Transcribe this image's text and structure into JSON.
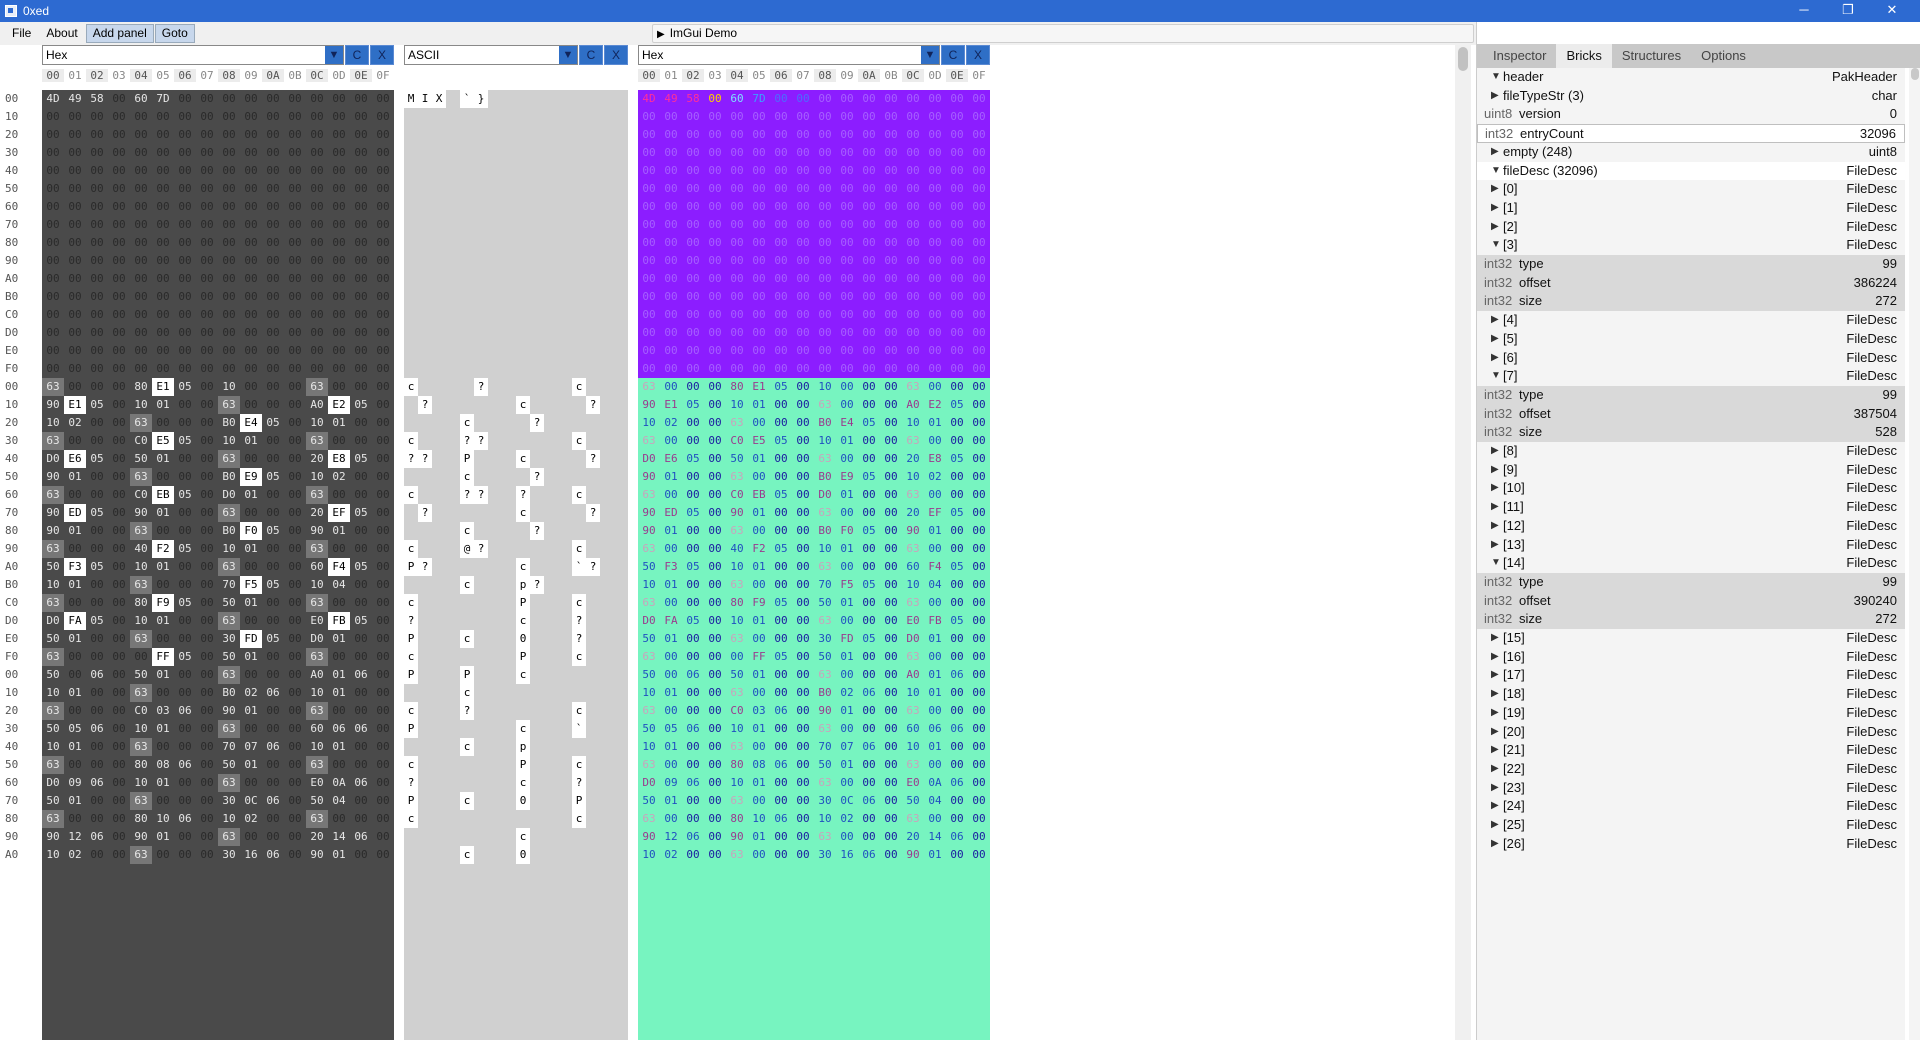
{
  "window": {
    "title": "0xed",
    "controls": [
      "─",
      "❐",
      "✕"
    ]
  },
  "menu": {
    "items": [
      "File",
      "About",
      "Add panel",
      "Goto"
    ],
    "demo_label": "ImGui Demo"
  },
  "panels": [
    {
      "name": "Hex",
      "buttons": [
        "C",
        "X"
      ]
    },
    {
      "name": "ASCII",
      "buttons": [
        "C",
        "X"
      ]
    },
    {
      "name": "Hex",
      "buttons": [
        "C",
        "X"
      ]
    }
  ],
  "col_headers": [
    "00",
    "01",
    "02",
    "03",
    "04",
    "05",
    "06",
    "07",
    "08",
    "09",
    "0A",
    "0B",
    "0C",
    "0D",
    "0E",
    "0F"
  ],
  "row_labels": [
    "00",
    "10",
    "20",
    "30",
    "40",
    "50",
    "60",
    "70",
    "80",
    "90",
    "A0",
    "B0",
    "C0",
    "D0",
    "E0",
    "F0",
    "00",
    "10",
    "20",
    "30",
    "40",
    "50",
    "60",
    "70",
    "80",
    "90",
    "A0",
    "B0",
    "C0",
    "D0",
    "E0",
    "F0",
    "00",
    "10",
    "20",
    "30",
    "40",
    "50",
    "60",
    "70",
    "80",
    "90",
    "A0"
  ],
  "hex_rows": [
    [
      "4D",
      "49",
      "58",
      "00",
      "60",
      "7D",
      "00",
      "00",
      "00",
      "00",
      "00",
      "00",
      "00",
      "00",
      "00",
      "00"
    ],
    [
      "00",
      "00",
      "00",
      "00",
      "00",
      "00",
      "00",
      "00",
      "00",
      "00",
      "00",
      "00",
      "00",
      "00",
      "00",
      "00"
    ],
    [
      "00",
      "00",
      "00",
      "00",
      "00",
      "00",
      "00",
      "00",
      "00",
      "00",
      "00",
      "00",
      "00",
      "00",
      "00",
      "00"
    ],
    [
      "00",
      "00",
      "00",
      "00",
      "00",
      "00",
      "00",
      "00",
      "00",
      "00",
      "00",
      "00",
      "00",
      "00",
      "00",
      "00"
    ],
    [
      "00",
      "00",
      "00",
      "00",
      "00",
      "00",
      "00",
      "00",
      "00",
      "00",
      "00",
      "00",
      "00",
      "00",
      "00",
      "00"
    ],
    [
      "00",
      "00",
      "00",
      "00",
      "00",
      "00",
      "00",
      "00",
      "00",
      "00",
      "00",
      "00",
      "00",
      "00",
      "00",
      "00"
    ],
    [
      "00",
      "00",
      "00",
      "00",
      "00",
      "00",
      "00",
      "00",
      "00",
      "00",
      "00",
      "00",
      "00",
      "00",
      "00",
      "00"
    ],
    [
      "00",
      "00",
      "00",
      "00",
      "00",
      "00",
      "00",
      "00",
      "00",
      "00",
      "00",
      "00",
      "00",
      "00",
      "00",
      "00"
    ],
    [
      "00",
      "00",
      "00",
      "00",
      "00",
      "00",
      "00",
      "00",
      "00",
      "00",
      "00",
      "00",
      "00",
      "00",
      "00",
      "00"
    ],
    [
      "00",
      "00",
      "00",
      "00",
      "00",
      "00",
      "00",
      "00",
      "00",
      "00",
      "00",
      "00",
      "00",
      "00",
      "00",
      "00"
    ],
    [
      "00",
      "00",
      "00",
      "00",
      "00",
      "00",
      "00",
      "00",
      "00",
      "00",
      "00",
      "00",
      "00",
      "00",
      "00",
      "00"
    ],
    [
      "00",
      "00",
      "00",
      "00",
      "00",
      "00",
      "00",
      "00",
      "00",
      "00",
      "00",
      "00",
      "00",
      "00",
      "00",
      "00"
    ],
    [
      "00",
      "00",
      "00",
      "00",
      "00",
      "00",
      "00",
      "00",
      "00",
      "00",
      "00",
      "00",
      "00",
      "00",
      "00",
      "00"
    ],
    [
      "00",
      "00",
      "00",
      "00",
      "00",
      "00",
      "00",
      "00",
      "00",
      "00",
      "00",
      "00",
      "00",
      "00",
      "00",
      "00"
    ],
    [
      "00",
      "00",
      "00",
      "00",
      "00",
      "00",
      "00",
      "00",
      "00",
      "00",
      "00",
      "00",
      "00",
      "00",
      "00",
      "00"
    ],
    [
      "00",
      "00",
      "00",
      "00",
      "00",
      "00",
      "00",
      "00",
      "00",
      "00",
      "00",
      "00",
      "00",
      "00",
      "00",
      "00"
    ],
    [
      "63",
      "00",
      "00",
      "00",
      "80",
      "E1",
      "05",
      "00",
      "10",
      "00",
      "00",
      "00",
      "63",
      "00",
      "00",
      "00"
    ],
    [
      "90",
      "E1",
      "05",
      "00",
      "10",
      "01",
      "00",
      "00",
      "63",
      "00",
      "00",
      "00",
      "A0",
      "E2",
      "05",
      "00"
    ],
    [
      "10",
      "02",
      "00",
      "00",
      "63",
      "00",
      "00",
      "00",
      "B0",
      "E4",
      "05",
      "00",
      "10",
      "01",
      "00",
      "00"
    ],
    [
      "63",
      "00",
      "00",
      "00",
      "C0",
      "E5",
      "05",
      "00",
      "10",
      "01",
      "00",
      "00",
      "63",
      "00",
      "00",
      "00"
    ],
    [
      "D0",
      "E6",
      "05",
      "00",
      "50",
      "01",
      "00",
      "00",
      "63",
      "00",
      "00",
      "00",
      "20",
      "E8",
      "05",
      "00"
    ],
    [
      "90",
      "01",
      "00",
      "00",
      "63",
      "00",
      "00",
      "00",
      "B0",
      "E9",
      "05",
      "00",
      "10",
      "02",
      "00",
      "00"
    ],
    [
      "63",
      "00",
      "00",
      "00",
      "C0",
      "EB",
      "05",
      "00",
      "D0",
      "01",
      "00",
      "00",
      "63",
      "00",
      "00",
      "00"
    ],
    [
      "90",
      "ED",
      "05",
      "00",
      "90",
      "01",
      "00",
      "00",
      "63",
      "00",
      "00",
      "00",
      "20",
      "EF",
      "05",
      "00"
    ],
    [
      "90",
      "01",
      "00",
      "00",
      "63",
      "00",
      "00",
      "00",
      "B0",
      "F0",
      "05",
      "00",
      "90",
      "01",
      "00",
      "00"
    ],
    [
      "63",
      "00",
      "00",
      "00",
      "40",
      "F2",
      "05",
      "00",
      "10",
      "01",
      "00",
      "00",
      "63",
      "00",
      "00",
      "00"
    ],
    [
      "50",
      "F3",
      "05",
      "00",
      "10",
      "01",
      "00",
      "00",
      "63",
      "00",
      "00",
      "00",
      "60",
      "F4",
      "05",
      "00"
    ],
    [
      "10",
      "01",
      "00",
      "00",
      "63",
      "00",
      "00",
      "00",
      "70",
      "F5",
      "05",
      "00",
      "10",
      "04",
      "00",
      "00"
    ],
    [
      "63",
      "00",
      "00",
      "00",
      "80",
      "F9",
      "05",
      "00",
      "50",
      "01",
      "00",
      "00",
      "63",
      "00",
      "00",
      "00"
    ],
    [
      "D0",
      "FA",
      "05",
      "00",
      "10",
      "01",
      "00",
      "00",
      "63",
      "00",
      "00",
      "00",
      "E0",
      "FB",
      "05",
      "00"
    ],
    [
      "50",
      "01",
      "00",
      "00",
      "63",
      "00",
      "00",
      "00",
      "30",
      "FD",
      "05",
      "00",
      "D0",
      "01",
      "00",
      "00"
    ],
    [
      "63",
      "00",
      "00",
      "00",
      "00",
      "FF",
      "05",
      "00",
      "50",
      "01",
      "00",
      "00",
      "63",
      "00",
      "00",
      "00"
    ],
    [
      "50",
      "00",
      "06",
      "00",
      "50",
      "01",
      "00",
      "00",
      "63",
      "00",
      "00",
      "00",
      "A0",
      "01",
      "06",
      "00"
    ],
    [
      "10",
      "01",
      "00",
      "00",
      "63",
      "00",
      "00",
      "00",
      "B0",
      "02",
      "06",
      "00",
      "10",
      "01",
      "00",
      "00"
    ],
    [
      "63",
      "00",
      "00",
      "00",
      "C0",
      "03",
      "06",
      "00",
      "90",
      "01",
      "00",
      "00",
      "63",
      "00",
      "00",
      "00"
    ],
    [
      "50",
      "05",
      "06",
      "00",
      "10",
      "01",
      "00",
      "00",
      "63",
      "00",
      "00",
      "00",
      "60",
      "06",
      "06",
      "00"
    ],
    [
      "10",
      "01",
      "00",
      "00",
      "63",
      "00",
      "00",
      "00",
      "70",
      "07",
      "06",
      "00",
      "10",
      "01",
      "00",
      "00"
    ],
    [
      "63",
      "00",
      "00",
      "00",
      "80",
      "08",
      "06",
      "00",
      "50",
      "01",
      "00",
      "00",
      "63",
      "00",
      "00",
      "00"
    ],
    [
      "D0",
      "09",
      "06",
      "00",
      "10",
      "01",
      "00",
      "00",
      "63",
      "00",
      "00",
      "00",
      "E0",
      "0A",
      "06",
      "00"
    ],
    [
      "50",
      "01",
      "00",
      "00",
      "63",
      "00",
      "00",
      "00",
      "30",
      "0C",
      "06",
      "00",
      "50",
      "04",
      "00",
      "00"
    ],
    [
      "63",
      "00",
      "00",
      "00",
      "80",
      "10",
      "06",
      "00",
      "10",
      "02",
      "00",
      "00",
      "63",
      "00",
      "00",
      "00"
    ],
    [
      "90",
      "12",
      "06",
      "00",
      "90",
      "01",
      "00",
      "00",
      "63",
      "00",
      "00",
      "00",
      "20",
      "14",
      "06",
      "00"
    ],
    [
      "10",
      "02",
      "00",
      "00",
      "63",
      "00",
      "00",
      "00",
      "30",
      "16",
      "06",
      "00",
      "90",
      "01",
      "00",
      "00"
    ]
  ],
  "ascii_rows": [
    [
      "M",
      "I",
      "X",
      "",
      "`",
      "}",
      "",
      "",
      "",
      "",
      "",
      "",
      "",
      "",
      "",
      ""
    ],
    [],
    [],
    [],
    [],
    [],
    [],
    [],
    [],
    [],
    [],
    [],
    [],
    [],
    [],
    [],
    [
      "c",
      "",
      "",
      "",
      "",
      "?",
      "",
      "",
      "",
      "",
      "",
      "",
      "c",
      "",
      "",
      ""
    ],
    [
      "",
      "?",
      "",
      "",
      "",
      "",
      "",
      "",
      "c",
      "",
      "",
      "",
      "",
      "?",
      "",
      ""
    ],
    [
      "",
      "",
      "",
      "",
      "c",
      "",
      "",
      "",
      "",
      "?",
      "",
      "",
      "",
      "",
      "",
      ""
    ],
    [
      "c",
      "",
      "",
      "",
      "?",
      "?",
      "",
      "",
      "",
      "",
      "",
      "",
      "c",
      "",
      "",
      ""
    ],
    [
      "?",
      "?",
      "",
      "",
      "P",
      "",
      "",
      "",
      "c",
      "",
      "",
      "",
      "",
      "?",
      "",
      ""
    ],
    [
      "",
      "",
      "",
      "",
      "c",
      "",
      "",
      "",
      "",
      "?",
      "",
      "",
      "",
      "",
      "",
      ""
    ],
    [
      "c",
      "",
      "",
      "",
      "?",
      "?",
      "",
      "",
      "?",
      "",
      "",
      "",
      "c",
      "",
      "",
      ""
    ],
    [
      "",
      "?",
      "",
      "",
      "",
      "",
      "",
      "",
      "c",
      "",
      "",
      "",
      "",
      "?",
      "",
      ""
    ],
    [
      "",
      "",
      "",
      "",
      "c",
      "",
      "",
      "",
      "",
      "?",
      "",
      "",
      "",
      "",
      "",
      ""
    ],
    [
      "c",
      "",
      "",
      "",
      "@",
      "?",
      "",
      "",
      "",
      "",
      "",
      "",
      "c",
      "",
      "",
      ""
    ],
    [
      "P",
      "?",
      "",
      "",
      "",
      "",
      "",
      "",
      "c",
      "",
      "",
      "",
      "`",
      "?",
      "",
      ""
    ],
    [
      "",
      "",
      "",
      "",
      "c",
      "",
      "",
      "",
      "p",
      "?",
      "",
      "",
      "",
      "",
      "",
      ""
    ],
    [
      "c",
      "",
      "",
      "",
      "",
      "",
      "",
      "",
      "P",
      "",
      "",
      "",
      "c",
      "",
      "",
      ""
    ],
    [
      "?",
      "",
      "",
      "",
      "",
      "",
      "",
      "",
      "c",
      "",
      "",
      "",
      "?",
      "",
      "",
      ""
    ],
    [
      "P",
      "",
      "",
      "",
      "c",
      "",
      "",
      "",
      "0",
      "",
      "",
      "",
      "?",
      "",
      "",
      ""
    ],
    [
      "c",
      "",
      "",
      "",
      "",
      "",
      "",
      "",
      "P",
      "",
      "",
      "",
      "c",
      "",
      "",
      ""
    ],
    [
      "P",
      "",
      "",
      "",
      "P",
      "",
      "",
      "",
      "c",
      "",
      "",
      "",
      "",
      "",
      "",
      ""
    ],
    [
      "",
      "",
      "",
      "",
      "c",
      "",
      "",
      "",
      "",
      "",
      "",
      "",
      "",
      "",
      "",
      ""
    ],
    [
      "c",
      "",
      "",
      "",
      "?",
      "",
      "",
      "",
      "",
      "",
      "",
      "",
      "c",
      "",
      "",
      ""
    ],
    [
      "P",
      "",
      "",
      "",
      "",
      "",
      "",
      "",
      "c",
      "",
      "",
      "",
      "`",
      "",
      "",
      ""
    ],
    [
      "",
      "",
      "",
      "",
      "c",
      "",
      "",
      "",
      "p",
      "",
      "",
      "",
      "",
      "",
      "",
      ""
    ],
    [
      "c",
      "",
      "",
      "",
      "",
      "",
      "",
      "",
      "P",
      "",
      "",
      "",
      "c",
      "",
      "",
      ""
    ],
    [
      "?",
      "",
      "",
      "",
      "",
      "",
      "",
      "",
      "c",
      "",
      "",
      "",
      "?",
      "",
      "",
      ""
    ],
    [
      "P",
      "",
      "",
      "",
      "c",
      "",
      "",
      "",
      "0",
      "",
      "",
      "",
      "P",
      "",
      "",
      ""
    ],
    [
      "c",
      "",
      "",
      "",
      "",
      "",
      "",
      "",
      "",
      "",
      "",
      "",
      "c",
      "",
      "",
      ""
    ],
    [
      "",
      "",
      "",
      "",
      "",
      "",
      "",
      "",
      "c",
      "",
      "",
      "",
      "",
      "",
      "",
      ""
    ],
    [
      "",
      "",
      "",
      "",
      "c",
      "",
      "",
      "",
      "0",
      "",
      "",
      "",
      "",
      "",
      "",
      ""
    ]
  ],
  "tabs": [
    "Inspector",
    "Bricks",
    "Structures",
    "Options"
  ],
  "active_tab": "Bricks",
  "tree": [
    {
      "kind": "node",
      "open": true,
      "label": "header",
      "value": "PakHeader"
    },
    {
      "kind": "node",
      "open": false,
      "label": "fileTypeStr (3)",
      "value": "char"
    },
    {
      "kind": "field",
      "type": "uint8",
      "label": "version",
      "value": "0"
    },
    {
      "kind": "field",
      "type": "int32",
      "label": "entryCount",
      "value": "32096",
      "selected": true
    },
    {
      "kind": "node",
      "open": false,
      "label": "empty (248)",
      "value": "uint8"
    },
    {
      "kind": "node",
      "open": true,
      "label": "fileDesc (32096)",
      "value": "FileDesc",
      "highlight": true
    },
    {
      "kind": "node",
      "open": false,
      "label": "[0]",
      "value": "FileDesc"
    },
    {
      "kind": "node",
      "open": false,
      "label": "[1]",
      "value": "FileDesc"
    },
    {
      "kind": "node",
      "open": false,
      "label": "[2]",
      "value": "FileDesc"
    },
    {
      "kind": "node",
      "open": true,
      "label": "[3]",
      "value": "FileDesc"
    },
    {
      "kind": "sub",
      "type": "int32",
      "label": "type",
      "value": "99"
    },
    {
      "kind": "sub",
      "type": "int32",
      "label": "offset",
      "value": "386224"
    },
    {
      "kind": "sub",
      "type": "int32",
      "label": "size",
      "value": "272"
    },
    {
      "kind": "node",
      "open": false,
      "label": "[4]",
      "value": "FileDesc"
    },
    {
      "kind": "node",
      "open": false,
      "label": "[5]",
      "value": "FileDesc"
    },
    {
      "kind": "node",
      "open": false,
      "label": "[6]",
      "value": "FileDesc"
    },
    {
      "kind": "node",
      "open": true,
      "label": "[7]",
      "value": "FileDesc"
    },
    {
      "kind": "sub",
      "type": "int32",
      "label": "type",
      "value": "99"
    },
    {
      "kind": "sub",
      "type": "int32",
      "label": "offset",
      "value": "387504"
    },
    {
      "kind": "sub",
      "type": "int32",
      "label": "size",
      "value": "528"
    },
    {
      "kind": "node",
      "open": false,
      "label": "[8]",
      "value": "FileDesc"
    },
    {
      "kind": "node",
      "open": false,
      "label": "[9]",
      "value": "FileDesc"
    },
    {
      "kind": "node",
      "open": false,
      "label": "[10]",
      "value": "FileDesc"
    },
    {
      "kind": "node",
      "open": false,
      "label": "[11]",
      "value": "FileDesc"
    },
    {
      "kind": "node",
      "open": false,
      "label": "[12]",
      "value": "FileDesc"
    },
    {
      "kind": "node",
      "open": false,
      "label": "[13]",
      "value": "FileDesc"
    },
    {
      "kind": "node",
      "open": true,
      "label": "[14]",
      "value": "FileDesc"
    },
    {
      "kind": "sub",
      "type": "int32",
      "label": "type",
      "value": "99"
    },
    {
      "kind": "sub",
      "type": "int32",
      "label": "offset",
      "value": "390240"
    },
    {
      "kind": "sub",
      "type": "int32",
      "label": "size",
      "value": "272"
    },
    {
      "kind": "node",
      "open": false,
      "label": "[15]",
      "value": "FileDesc"
    },
    {
      "kind": "node",
      "open": false,
      "label": "[16]",
      "value": "FileDesc"
    },
    {
      "kind": "node",
      "open": false,
      "label": "[17]",
      "value": "FileDesc"
    },
    {
      "kind": "node",
      "open": false,
      "label": "[18]",
      "value": "FileDesc"
    },
    {
      "kind": "node",
      "open": false,
      "label": "[19]",
      "value": "FileDesc"
    },
    {
      "kind": "node",
      "open": false,
      "label": "[20]",
      "value": "FileDesc"
    },
    {
      "kind": "node",
      "open": false,
      "label": "[21]",
      "value": "FileDesc"
    },
    {
      "kind": "node",
      "open": false,
      "label": "[22]",
      "value": "FileDesc"
    },
    {
      "kind": "node",
      "open": false,
      "label": "[23]",
      "value": "FileDesc"
    },
    {
      "kind": "node",
      "open": false,
      "label": "[24]",
      "value": "FileDesc"
    },
    {
      "kind": "node",
      "open": false,
      "label": "[25]",
      "value": "FileDesc"
    },
    {
      "kind": "node",
      "open": false,
      "label": "[26]",
      "value": "FileDesc"
    }
  ]
}
